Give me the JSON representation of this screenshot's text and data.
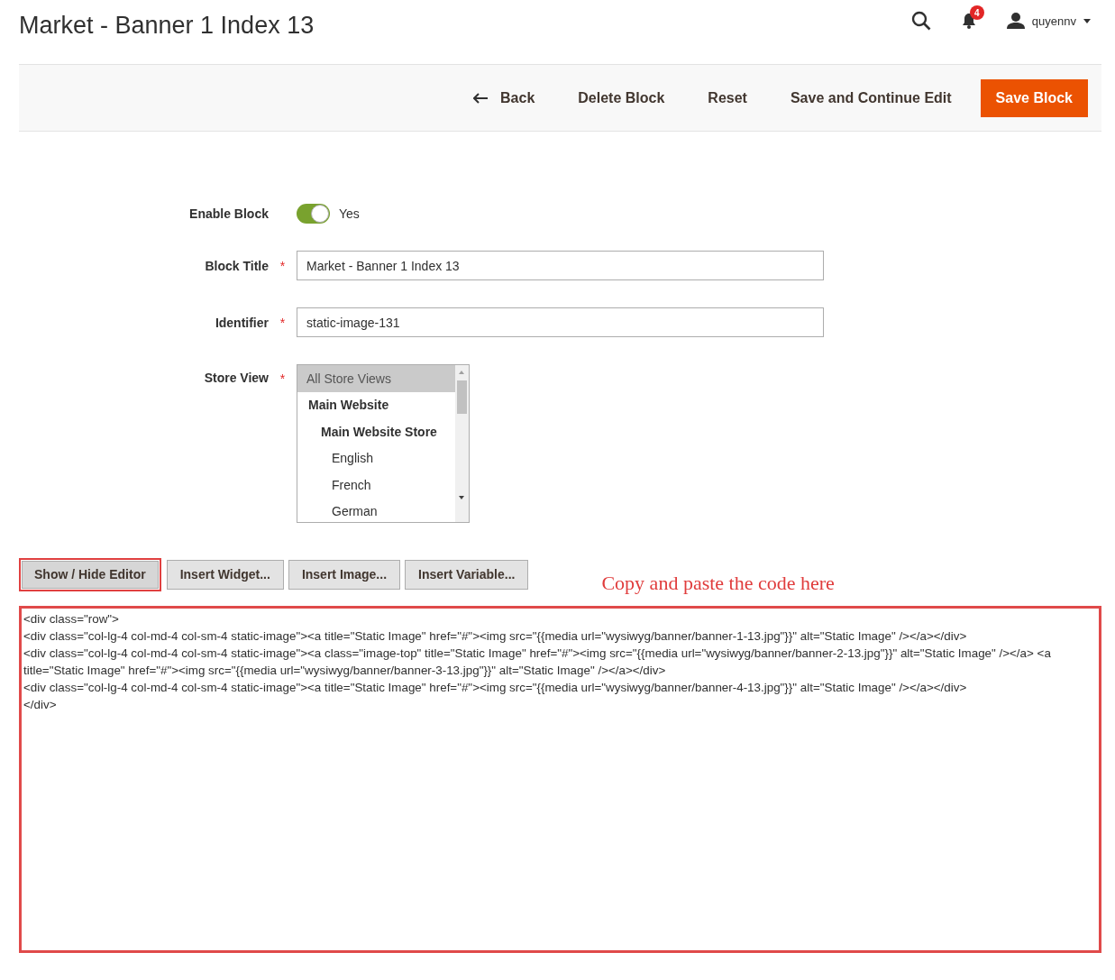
{
  "page_title": "Market - Banner 1 Index 13",
  "header": {
    "notifications_count": "4",
    "user_name": "quyennv"
  },
  "actions": [
    {
      "label": "Back",
      "kind": "back"
    },
    {
      "label": "Delete Block",
      "kind": "plain"
    },
    {
      "label": "Reset",
      "kind": "plain"
    },
    {
      "label": "Save and Continue Edit",
      "kind": "plain"
    },
    {
      "label": "Save Block",
      "kind": "primary"
    }
  ],
  "form": {
    "enable_block": {
      "label": "Enable Block",
      "on": true,
      "value_label": "Yes"
    },
    "block_title": {
      "label": "Block Title",
      "required_mark": "*",
      "value": "Market - Banner 1 Index 13"
    },
    "identifier": {
      "label": "Identifier",
      "required_mark": "*",
      "value": "static-image-131"
    },
    "store_view": {
      "label": "Store View",
      "required_mark": "*",
      "options": [
        {
          "label": "All Store Views",
          "selected": true
        },
        {
          "label": "Main Website",
          "selected": false,
          "children": [
            {
              "label": "Main Website Store",
              "selected": false,
              "children": [
                {
                  "label": "English",
                  "selected": false
                },
                {
                  "label": "French",
                  "selected": false
                },
                {
                  "label": "German",
                  "selected": false
                }
              ]
            }
          ]
        }
      ]
    }
  },
  "editor_buttons": [
    {
      "label": "Show / Hide Editor",
      "highlighted": true
    },
    {
      "label": "Insert Widget...",
      "highlighted": false
    },
    {
      "label": "Insert Image...",
      "highlighted": false
    },
    {
      "label": "Insert Variable...",
      "highlighted": false
    }
  ],
  "annotation": "Copy and paste the code here",
  "code_editor": {
    "highlighted": true,
    "lines": [
      "<div class=\"row\">",
      "<div class=\"col-lg-4 col-md-4 col-sm-4 static-image\"><a title=\"Static Image\" href=\"#\"><img src=\"{{media url=\"wysiwyg/banner/banner-1-13.jpg\"}}\" alt=\"Static Image\" /></a></div>",
      "<div class=\"col-lg-4 col-md-4 col-sm-4 static-image\"><a class=\"image-top\" title=\"Static Image\" href=\"#\"><img src=\"{{media url=\"wysiwyg/banner/banner-2-13.jpg\"}}\" alt=\"Static Image\" /></a> <a title=\"Static Image\" href=\"#\"><img src=\"{{media url=\"wysiwyg/banner/banner-3-13.jpg\"}}\" alt=\"Static Image\" /></a></div>",
      "<div class=\"col-lg-4 col-md-4 col-sm-4 static-image\"><a title=\"Static Image\" href=\"#\"><img src=\"{{media url=\"wysiwyg/banner/banner-4-13.jpg\"}}\" alt=\"Static Image\" /></a></div>",
      "</div>"
    ]
  }
}
